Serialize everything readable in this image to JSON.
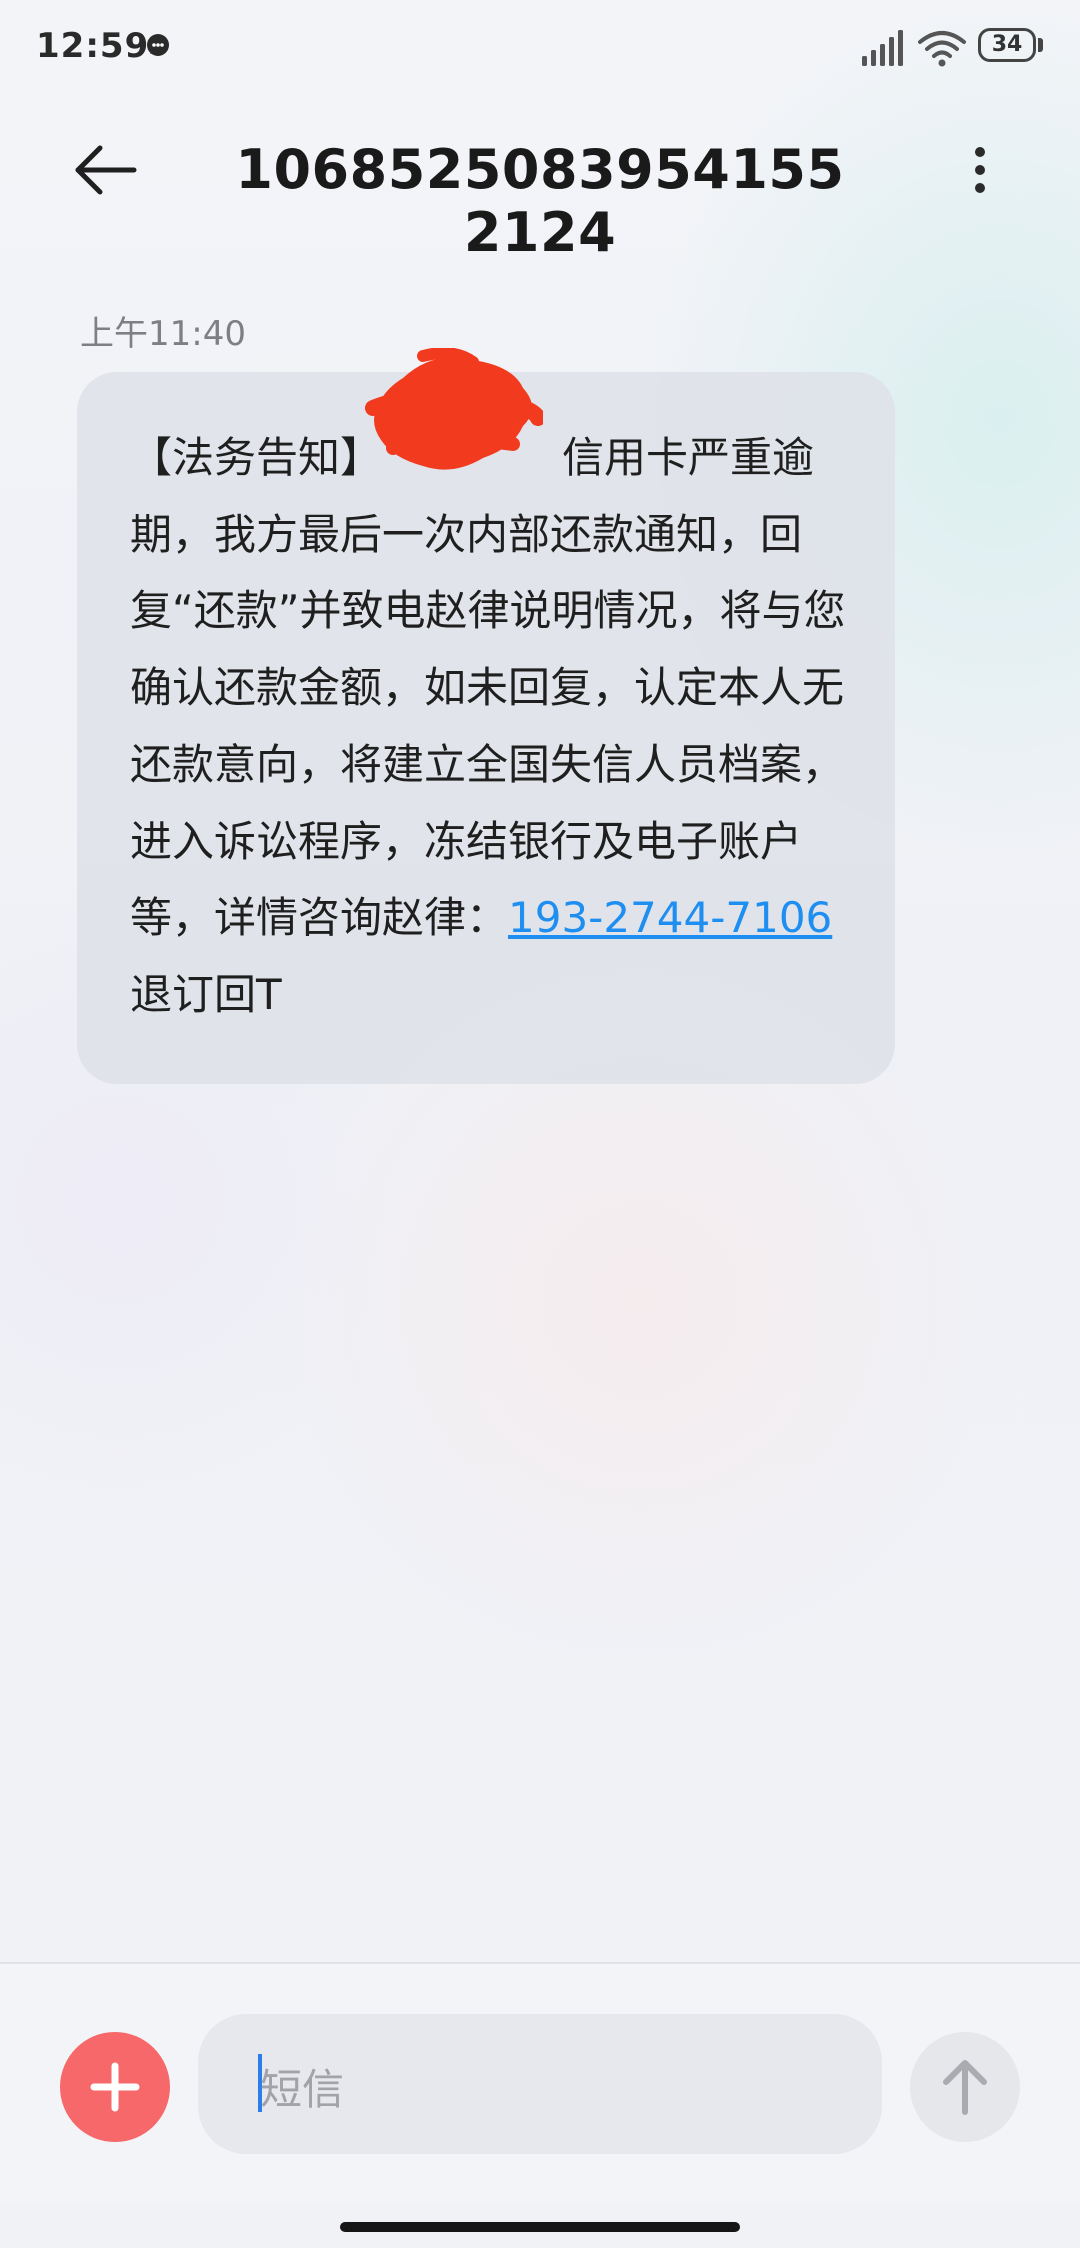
{
  "status_bar": {
    "time": "12:59",
    "battery": "34"
  },
  "header": {
    "title": "1068525083954155 2124"
  },
  "conversation": {
    "timestamp": "上午11:40",
    "message": {
      "text_before_redaction": "【法务告知】",
      "text_after_redaction": "信用卡严重逾期，我方最后一次内部还款通知，回复“还款”并致电赵律说明情况，将与您确认还款金额，如未回复，认定本人无还款意向，将建立全国失信人员档案，进入诉讼程序，冻结银行及电子账户等，详情咨询赵律：",
      "phone_link": "193-2744-7106",
      "text_end": "退订回T"
    }
  },
  "composer": {
    "placeholder": "短信"
  },
  "colors": {
    "add_button": "#f6686a",
    "link": "#1f8ef1",
    "cursor": "#2b7de9",
    "redaction": "#f23a1f"
  },
  "icons": {
    "back": "arrow-left-icon",
    "more": "more-vertical-icon",
    "add": "plus-icon",
    "send": "arrow-up-icon",
    "signal": "signal-icon",
    "wifi": "wifi-icon",
    "battery": "battery-icon",
    "notification": "message-icon"
  }
}
